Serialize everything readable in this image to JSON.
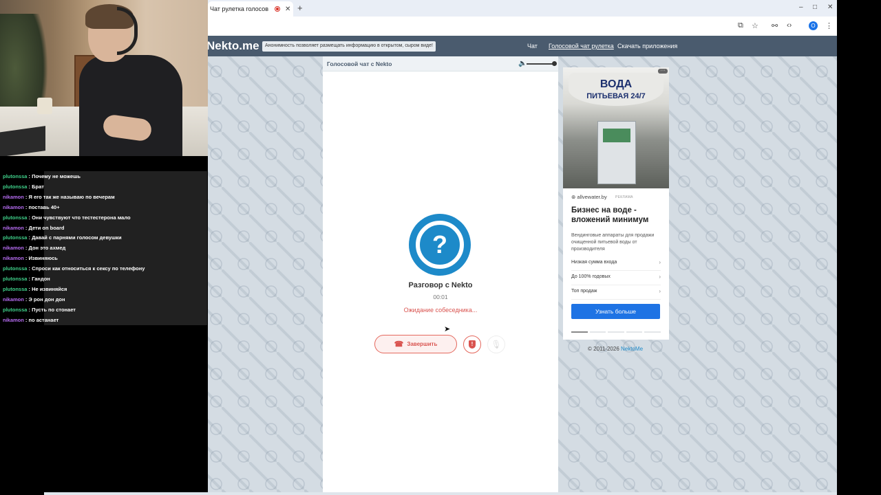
{
  "browser": {
    "tab_title": "Чат рулетка голосов",
    "new_tab": "+",
    "window_controls": [
      "–",
      "□",
      "✕"
    ],
    "profile_initial": "O"
  },
  "site": {
    "logo": "Nekto.me",
    "anon_note": "Анонимность позволяет размещать информацию в открытом, сыром виде!",
    "nav": {
      "chat": "Чат",
      "voice_chat": "Голосовой чат рулетка",
      "download": "Скачать приложения"
    },
    "card": {
      "title": "Голосовой чат с Nekto",
      "avatar_glyph": "?",
      "conversation_title": "Разговор с Nekto",
      "timer": "00:01",
      "status": "Ожидание собеседника...",
      "end_button": "Завершить",
      "volume_level": 1.0
    },
    "ad": {
      "image_title": "ВОДА",
      "image_subtitle": "ПИТЬЕВАЯ 24/7",
      "source": "allvewater.by",
      "label": "РЕКЛАМА",
      "headline": "Бизнес на воде - вложений минимум",
      "body": "Вендинговые аппараты для продажи очищенной питьевой воды от производителя",
      "rows": [
        "Низкая сумма входа",
        "До 100% годовых",
        "Топ продаж"
      ],
      "button": "Узнать больше"
    },
    "copyright_prefix": "© 2011-2026 ",
    "copyright_link": "NektoMe"
  },
  "stream_chat": {
    "colors": {
      "plutonssa": "#3fd08a",
      "nikamon": "#b56cf0"
    },
    "messages": [
      {
        "user": "plutonssa",
        "text": "Почему не можешь"
      },
      {
        "user": "plutonssa",
        "text": "Брат"
      },
      {
        "user": "nikamon",
        "text": "Я его так же называю по вечерам"
      },
      {
        "user": "nikamon",
        "text": "поставь 40+"
      },
      {
        "user": "plutonssa",
        "text": "Они чувствуют что тестестерона мало"
      },
      {
        "user": "nikamon",
        "text": "Дети on board"
      },
      {
        "user": "plutonssa",
        "text": "Давай с парнями голосом девушки"
      },
      {
        "user": "nikamon",
        "text": "Дон это ахмед"
      },
      {
        "user": "nikamon",
        "text": "Извиняюсь"
      },
      {
        "user": "plutonssa",
        "text": "Спроси как относиться к сексу по телефону"
      },
      {
        "user": "plutonssa",
        "text": "Гандон"
      },
      {
        "user": "plutonssa",
        "text": "Не извиняйся"
      },
      {
        "user": "nikamon",
        "text": "Э рон дон дон"
      },
      {
        "user": "plutonssa",
        "text": "Пусть по стонает"
      },
      {
        "user": "nikamon",
        "text": "по астанает"
      }
    ]
  }
}
